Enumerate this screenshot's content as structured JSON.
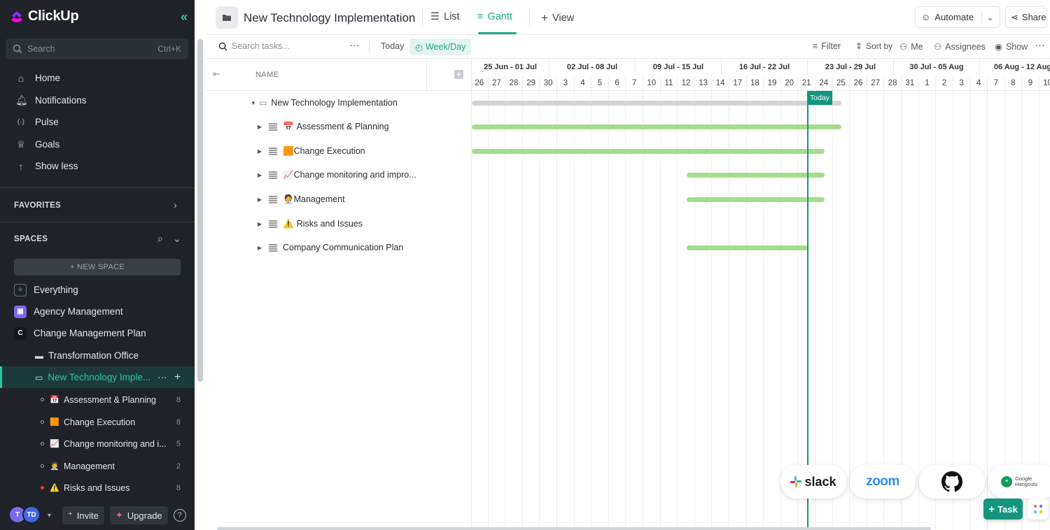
{
  "app": {
    "name": "ClickUp"
  },
  "sidebar": {
    "search_placeholder": "Search",
    "search_shortcut": "Ctrl+K",
    "nav": [
      {
        "label": "Home",
        "icon": "home-icon"
      },
      {
        "label": "Notifications",
        "icon": "bell-icon"
      },
      {
        "label": "Pulse",
        "icon": "pulse-icon"
      },
      {
        "label": "Goals",
        "icon": "trophy-icon"
      },
      {
        "label": "Show less",
        "icon": "arrow-up-icon"
      }
    ],
    "favorites_label": "FAVORITES",
    "spaces_label": "SPACES",
    "new_space_label": "+ NEW SPACE",
    "spaces": [
      {
        "label": "Everything"
      },
      {
        "label": "Agency Management"
      },
      {
        "label": "Change Management Plan",
        "badge": "C"
      }
    ],
    "folders": [
      {
        "label": "Transformation Office"
      },
      {
        "label": "New Technology Imple..."
      }
    ],
    "lists": [
      {
        "label": "Assessment & Planning",
        "emoji": "📅",
        "count": "8"
      },
      {
        "label": "Change Execution",
        "emoji": "🟧",
        "count": "8"
      },
      {
        "label": "Change monitoring and i...",
        "emoji": "📈",
        "count": "5"
      },
      {
        "label": "Management",
        "emoji": "🧑‍💼",
        "count": "2"
      },
      {
        "label": "Risks and Issues",
        "emoji": "⚠️",
        "count": "8"
      }
    ],
    "bottom": {
      "avatar1": "T",
      "avatar2": "TD",
      "invite": "Invite",
      "upgrade": "Upgrade",
      "help": "?"
    }
  },
  "header": {
    "title": "New Technology Implementation",
    "tabs": [
      {
        "label": "List"
      },
      {
        "label": "Gantt"
      },
      {
        "label": "View"
      }
    ],
    "automate": "Automate",
    "share": "Share"
  },
  "toolbar": {
    "search_placeholder": "Search tasks...",
    "today": "Today",
    "week_day": "Week/Day",
    "filter": "Filter",
    "sort_by": "Sort by",
    "me": "Me",
    "assignees": "Assignees",
    "show": "Show"
  },
  "tasklist": {
    "column_name": "NAME",
    "folder": "New Technology Implementation",
    "rows": [
      {
        "label": "Assessment & Planning",
        "emoji": "📅"
      },
      {
        "label": "Change Execution",
        "emoji": "🟧"
      },
      {
        "label": "Change monitoring and impro...",
        "emoji": "📈"
      },
      {
        "label": "Management",
        "emoji": "🧑‍💼"
      },
      {
        "label": "Risks and Issues",
        "emoji": "⚠️"
      },
      {
        "label": "Company Communication Plan",
        "emoji": ""
      }
    ]
  },
  "gantt": {
    "weeks": [
      "25 Jun - 01 Jul",
      "02 Jul - 08 Jul",
      "09 Jul - 15 Jul",
      "16 Jul - 22 Jul",
      "23 Jul - 29 Jul",
      "30 Jul - 05 Aug",
      "06 Aug - 12 Aug"
    ],
    "days": [
      "26",
      "27",
      "28",
      "29",
      "30",
      "3",
      "4",
      "5",
      "6",
      "7",
      "10",
      "11",
      "12",
      "13",
      "14",
      "17",
      "18",
      "19",
      "20",
      "21",
      "24",
      "25",
      "26",
      "27",
      "28",
      "31",
      "1",
      "2",
      "3",
      "4",
      "7",
      "8",
      "9",
      "10"
    ],
    "today_label": "Today",
    "bar_color": "#a6dc8e",
    "folder_bar_color": "#d3d4d6",
    "accent": "#14967e"
  },
  "integrations": [
    "slack",
    "zoom",
    "github-icon",
    "Google Hangouts"
  ],
  "fab": {
    "task": "Task"
  }
}
